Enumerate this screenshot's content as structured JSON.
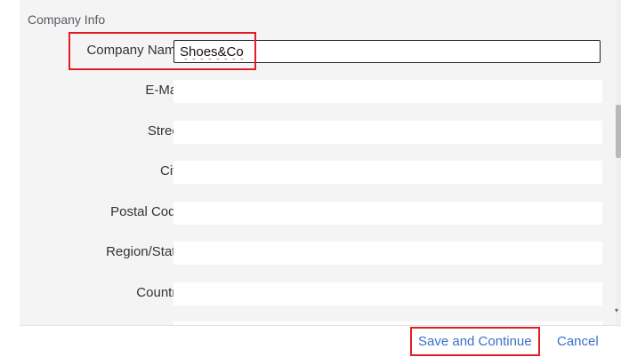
{
  "section": {
    "title": "Company Info"
  },
  "fields": [
    {
      "label": "Company Name:",
      "value": "Shoes&Co"
    },
    {
      "label": "E-Mail:",
      "value": ""
    },
    {
      "label": "Street:",
      "value": ""
    },
    {
      "label": "City:",
      "value": ""
    },
    {
      "label": "Postal Code:",
      "value": ""
    },
    {
      "label": "Region/State:",
      "value": ""
    },
    {
      "label": "Country:",
      "value": ""
    }
  ],
  "footer": {
    "save_label": "Save and Continue",
    "cancel_label": "Cancel"
  },
  "colors": {
    "link": "#3a6fc9",
    "highlight": "#e01e26",
    "panel_bg": "#f4f4f4"
  }
}
